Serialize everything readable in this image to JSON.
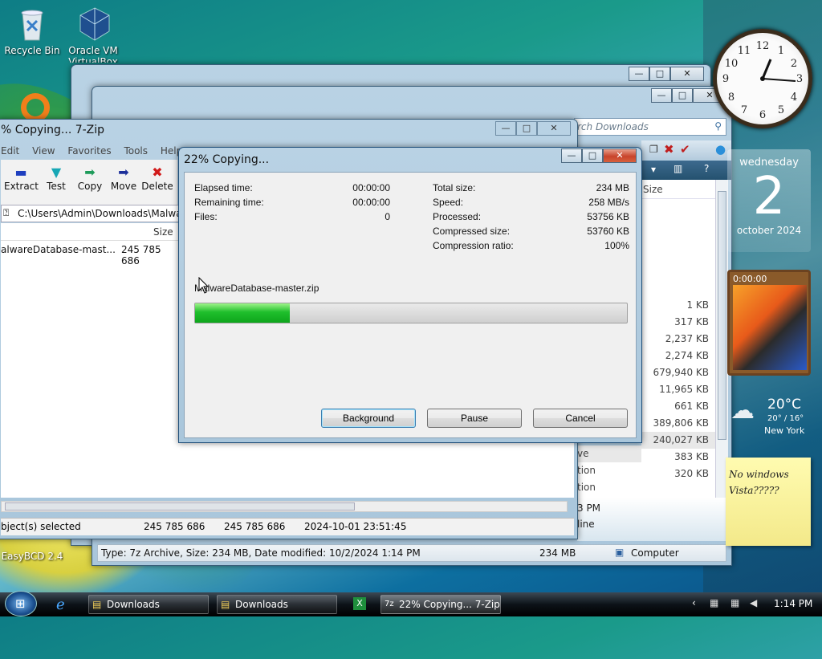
{
  "desktop": {
    "icons": [
      {
        "label": "Recycle Bin"
      },
      {
        "label": "Oracle VM VirtualBox"
      },
      {
        "label": "EasyBCD 2.4"
      }
    ]
  },
  "gadgets": {
    "calendar": {
      "weekday": "wednesday",
      "day": "2",
      "month_year": "october 2024"
    },
    "timer": "0:00:00",
    "weather": {
      "temp": "20°C",
      "range": "20° / 16°",
      "city": "New York"
    },
    "note": {
      "line1": "No windows",
      "line2": "Vista?????"
    }
  },
  "sevenzip": {
    "title": "% Copying... 7-Zip",
    "menu": [
      "Edit",
      "View",
      "Favorites",
      "Tools",
      "Help"
    ],
    "toolbar": [
      {
        "label": "Extract",
        "icon": "extract-icon",
        "color": "#1f3fbf"
      },
      {
        "label": "Test",
        "icon": "test-icon",
        "color": "#17a7b5"
      },
      {
        "label": "Copy",
        "icon": "copy-icon",
        "color": "#1e9b5a"
      },
      {
        "label": "Move",
        "icon": "move-icon",
        "color": "#1c2f9a"
      },
      {
        "label": "Delete",
        "icon": "delete-icon",
        "color": "#d11a1a"
      }
    ],
    "path": "C:\\Users\\Admin\\Downloads\\MalwareD",
    "column_size": "Size",
    "row": {
      "name": "alwareDatabase-mast...",
      "size": "245 785 686"
    },
    "status": {
      "selected": "bject(s) selected",
      "size1": "245 785 686",
      "size2": "245 785 686",
      "date": "2024-10-01 23:51:45"
    }
  },
  "explorer": {
    "search_placeholder": "rch Downloads",
    "column_size": "Size",
    "sizes": [
      "1 KB",
      "317 KB",
      "2,237 KB",
      "2,274 KB",
      "679,940 KB",
      "11,965 KB",
      "661 KB",
      "389,806 KB",
      "240,027 KB",
      "383 KB",
      "320 KB"
    ],
    "row_fragments": [
      "ve",
      "tion",
      "tion"
    ],
    "detail_time": "3 PM",
    "detail_state": "line",
    "status": {
      "info": "Type: 7z Archive, Size: 234 MB, Date modified: 10/2/2024 1:14 PM",
      "size": "234 MB",
      "location": "Computer"
    }
  },
  "dialog": {
    "title": "22% Copying...",
    "left": [
      {
        "label": "Elapsed time:",
        "value": "00:00:00"
      },
      {
        "label": "Remaining time:",
        "value": "00:00:00"
      },
      {
        "label": "Files:",
        "value": "0"
      }
    ],
    "right": [
      {
        "label": "Total size:",
        "value": "234 MB"
      },
      {
        "label": "Speed:",
        "value": "258 MB/s"
      },
      {
        "label": "Processed:",
        "value": "53756 KB"
      },
      {
        "label": "Compressed size:",
        "value": "53760 KB"
      },
      {
        "label": "Compression ratio:",
        "value": "100%"
      }
    ],
    "filename": "MalwareDatabase-master.zip",
    "progress": 0.22,
    "progress_color": "#1fbf2c",
    "buttons": {
      "background": "Background",
      "pause": "Pause",
      "cancel": "Cancel"
    }
  },
  "taskbar": {
    "items": [
      {
        "label": "Downloads"
      },
      {
        "label": "Downloads"
      },
      {
        "label": "22% Copying... 7-Zip"
      }
    ],
    "clock": "1:14 PM"
  }
}
